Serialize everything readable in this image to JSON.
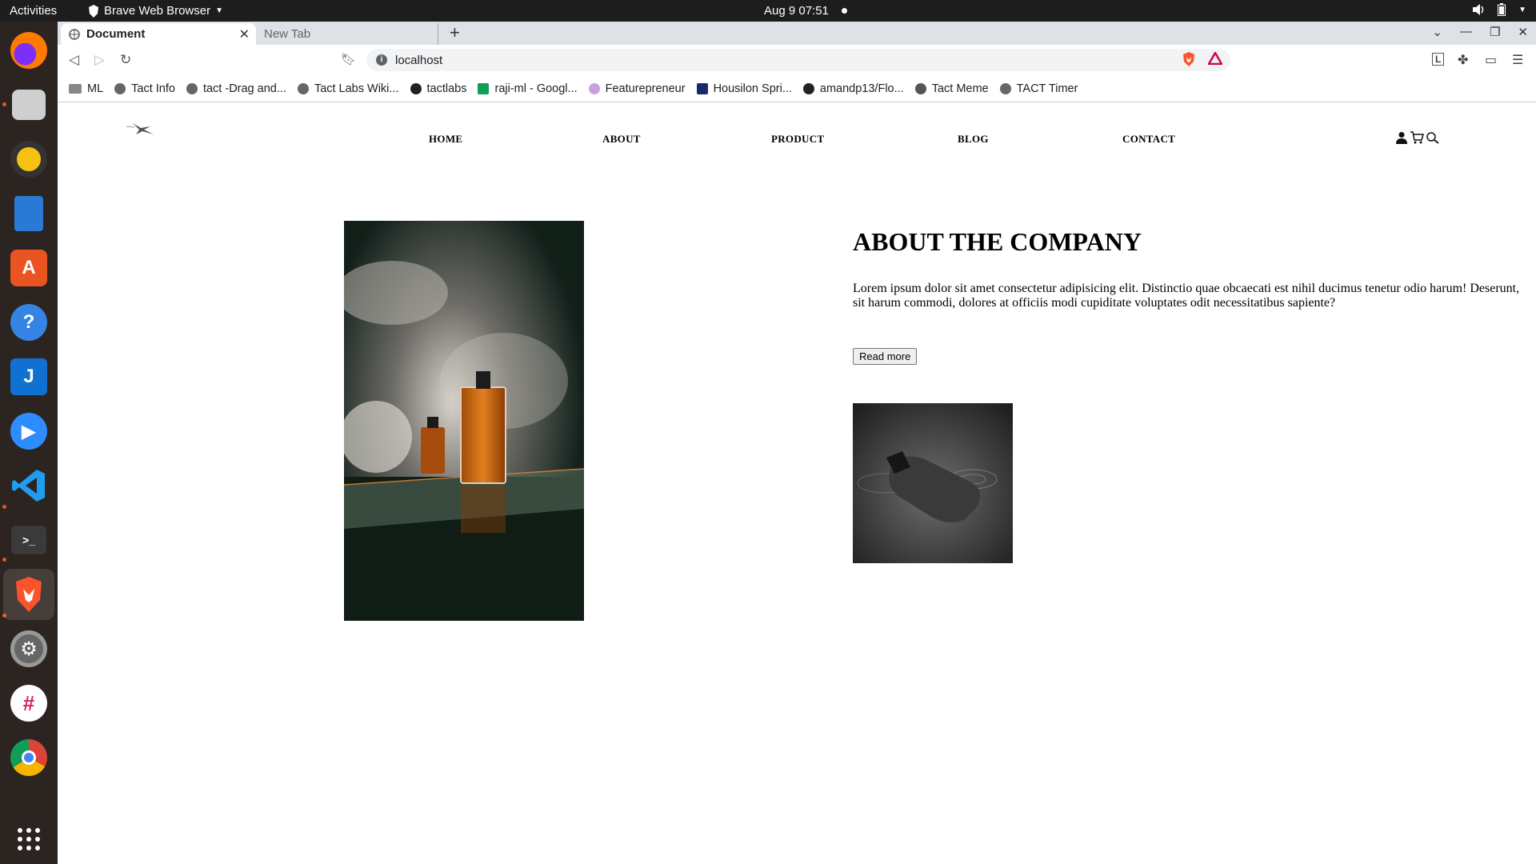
{
  "os": {
    "activities": "Activities",
    "app_name": "Brave Web Browser",
    "clock": "Aug 9  07:51"
  },
  "browser": {
    "tabs": [
      {
        "title": "Document",
        "active": true
      },
      {
        "title": "New Tab",
        "active": false
      }
    ],
    "url": "localhost",
    "bookmarks": [
      "ML",
      "Tact Info",
      "tact -Drag and...",
      "Tact Labs Wiki...",
      "tactlabs",
      "raji-ml - Googl...",
      "Featurepreneur",
      "Housilon Spri...",
      "amandp13/Flo...",
      "Tact Meme",
      "TACT Timer"
    ]
  },
  "site": {
    "nav": [
      "HOME",
      "ABOUT",
      "PRODUCT",
      "BLOG",
      "CONTACT"
    ],
    "about": {
      "title": "ABOUT THE COMPANY",
      "text": "Lorem ipsum dolor sit amet consectetur adipisicing elit. Distinctio quae obcaecati est nihil ducimus tenetur odio harum! Deserunt, sit harum commodi, dolores at officiis modi cupiditate voluptates odit necessitatibus sapiente?",
      "button": "Read more"
    }
  },
  "colors": {
    "topbar": "#1d1d1d",
    "dock": "#2c2420",
    "tabstrip": "#dee1e6",
    "ubuntu_orange": "#e95420"
  }
}
